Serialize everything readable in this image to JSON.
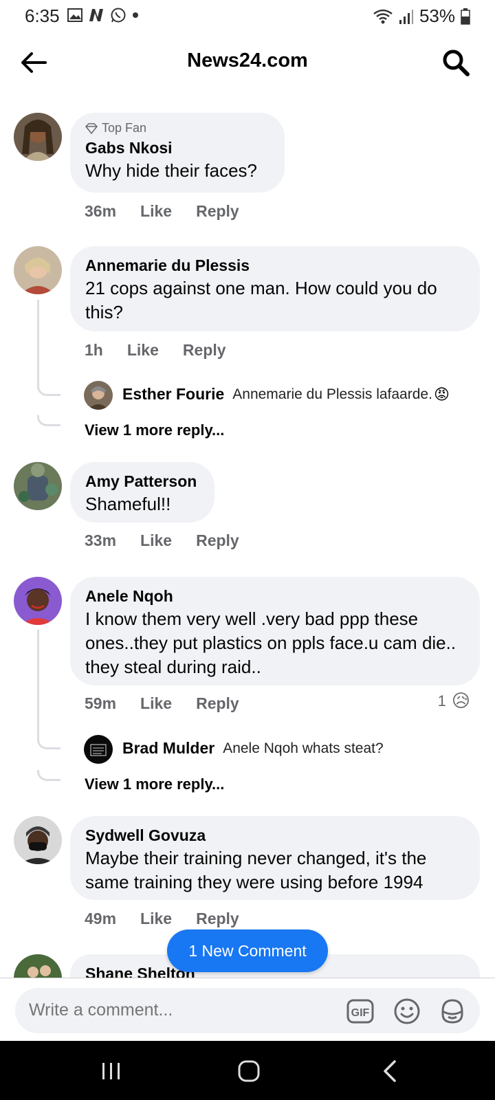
{
  "status_bar": {
    "time": "6:35",
    "battery": "53%"
  },
  "header": {
    "title": "News24.com"
  },
  "comments": [
    {
      "badge": "Top Fan",
      "author": "Gabs Nkosi",
      "text": "Why hide their faces?",
      "time": "36m",
      "like": "Like",
      "reply": "Reply"
    },
    {
      "author": "Annemarie du Plessis",
      "text": "21 cops against one man. How could you do this?",
      "time": "1h",
      "like": "Like",
      "reply": "Reply",
      "reply_preview": {
        "author": "Esther Fourie",
        "text": "Annemarie du Plessis lafaarde.",
        "emoji": "😡"
      },
      "view_more": "View 1 more reply..."
    },
    {
      "author": "Amy Patterson",
      "text": "Shameful!!",
      "time": "33m",
      "like": "Like",
      "reply": "Reply"
    },
    {
      "author": "Anele Nqoh",
      "text": "I know them very well .very bad ppp these ones..they put plastics on ppls face.u cam die.. they steal during raid..",
      "time": "59m",
      "like": "Like",
      "reply": "Reply",
      "reaction": {
        "count": "1",
        "emoji": "😥"
      },
      "reply_preview": {
        "author": "Brad Mulder",
        "text": "Anele Nqoh whats steat?"
      },
      "view_more": "View 1 more reply..."
    },
    {
      "author": "Sydwell Govuza",
      "text": "Maybe their training never changed, it's the same training they were using before 1994",
      "time": "49m",
      "like": "Like",
      "reply": "Reply"
    },
    {
      "author": "Shane Shelton"
    }
  ],
  "new_comment_pill": "1 New Comment",
  "composer": {
    "placeholder": "Write a comment...",
    "gif_label": "GIF"
  },
  "colors": {
    "accent": "#1877f2",
    "bubble": "#f0f2f5",
    "meta": "#65676b"
  }
}
